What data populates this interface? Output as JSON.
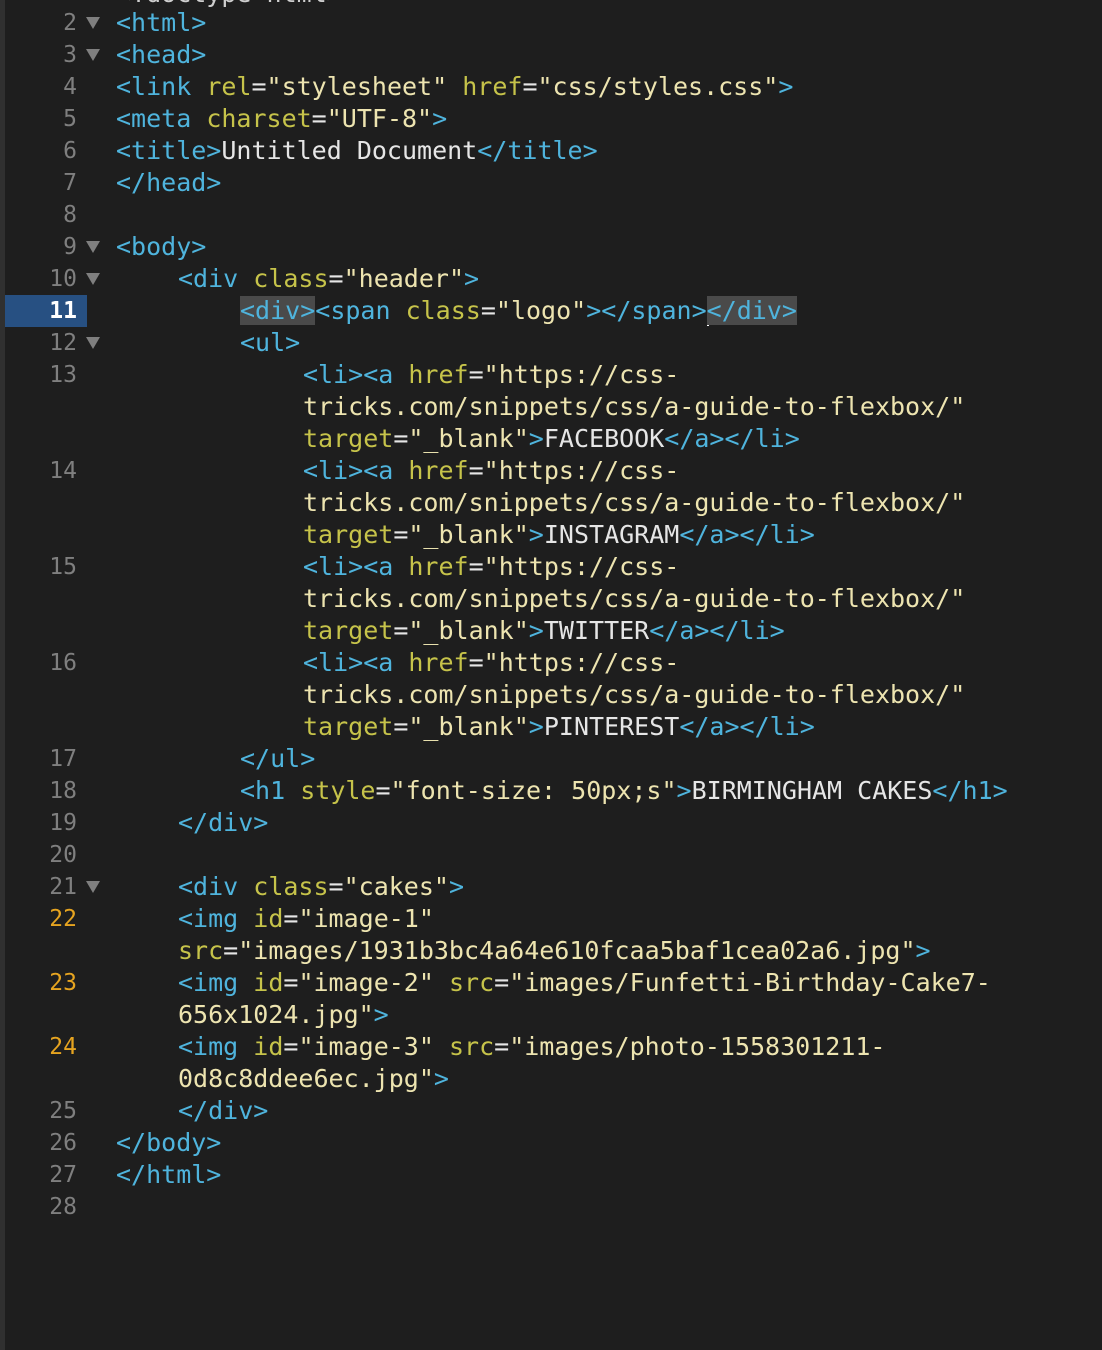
{
  "top_partial": "<!doctype html>",
  "lines": {
    "l2": {
      "num": "2",
      "t1": "<html>"
    },
    "l3": {
      "num": "3",
      "t1": "<head>"
    },
    "l4": {
      "num": "4",
      "t1": "<link ",
      "a1": "rel",
      "e1": "=",
      "s1": "\"stylesheet\"",
      "sp": " ",
      "a2": "href",
      "e2": "=",
      "s2": "\"css/styles.css\"",
      "t2": ">"
    },
    "l5": {
      "num": "5",
      "t1": "<meta ",
      "a1": "charset",
      "e1": "=",
      "s1": "\"UTF-8\"",
      "t2": ">"
    },
    "l6": {
      "num": "6",
      "t1": "<title>",
      "x1": "Untitled Document",
      "t2": "</title>"
    },
    "l7": {
      "num": "7",
      "t1": "</head>"
    },
    "l8": {
      "num": "8"
    },
    "l9": {
      "num": "9",
      "t1": "<body>"
    },
    "l10": {
      "num": "10",
      "t1": "<div ",
      "a1": "class",
      "e1": "=",
      "s1": "\"header\"",
      "t2": ">"
    },
    "l11": {
      "num": "11",
      "t1": "<div>",
      "t2": "<span ",
      "a1": "class",
      "e1": "=",
      "s1": "\"logo\"",
      "t3": "></span>",
      "t4": "</div>"
    },
    "l12": {
      "num": "12",
      "t1": "<ul>"
    },
    "l13": {
      "num": "13",
      "r1_t": "<li><a ",
      "r1_a": "href",
      "r1_e": "=",
      "r1_s": "\"https://css-",
      "r2_s": "tricks.com/snippets/css/a-guide-to-flexbox/\"",
      "r3_a": "target",
      "r3_e": "=",
      "r3_s": "\"_blank\"",
      "r3_t1": ">",
      "r3_x": "FACEBOOK",
      "r3_t2": "</a></li>"
    },
    "l14": {
      "num": "14",
      "r1_t": "<li><a ",
      "r1_a": "href",
      "r1_e": "=",
      "r1_s": "\"https://css-",
      "r2_s": "tricks.com/snippets/css/a-guide-to-flexbox/\"",
      "r3_a": "target",
      "r3_e": "=",
      "r3_s": "\"_blank\"",
      "r3_t1": ">",
      "r3_x": "INSTAGRAM",
      "r3_t2": "</a></li>"
    },
    "l15": {
      "num": "15",
      "r1_t": "<li><a ",
      "r1_a": "href",
      "r1_e": "=",
      "r1_s": "\"https://css-",
      "r2_s": "tricks.com/snippets/css/a-guide-to-flexbox/\"",
      "r3_a": "target",
      "r3_e": "=",
      "r3_s": "\"_blank\"",
      "r3_t1": ">",
      "r3_x": "TWITTER",
      "r3_t2": "</a></li>"
    },
    "l16": {
      "num": "16",
      "r1_t": "<li><a ",
      "r1_a": "href",
      "r1_e": "=",
      "r1_s": "\"https://css-",
      "r2_s": "tricks.com/snippets/css/a-guide-to-flexbox/\"",
      "r3_a": "target",
      "r3_e": "=",
      "r3_s": "\"_blank\"",
      "r3_t1": ">",
      "r3_x": "PINTEREST",
      "r3_t2": "</a></li>"
    },
    "l17": {
      "num": "17",
      "t1": "</ul>"
    },
    "l18": {
      "num": "18",
      "t1": "<h1 ",
      "a1": "style",
      "e1": "=",
      "s1": "\"font-size: 50px;s\"",
      "t2": ">",
      "x1": "BIRMINGHAM CAKES",
      "t3": "</h1>"
    },
    "l19": {
      "num": "19",
      "t1": "</div>"
    },
    "l20": {
      "num": "20"
    },
    "l21": {
      "num": "21",
      "t1": "<div ",
      "a1": "class",
      "e1": "=",
      "s1": "\"cakes\"",
      "t2": ">"
    },
    "l22": {
      "num": "22",
      "r1_t": "<img ",
      "r1_a": "id",
      "r1_e": "=",
      "r1_s": "\"image-1\"",
      "r2_a": "src",
      "r2_e": "=",
      "r2_s": "\"images/1931b3bc4a64e610fcaa5baf1cea02a6.jpg\"",
      "r2_t": ">"
    },
    "l23": {
      "num": "23",
      "r1_t": "<img ",
      "r1_a": "id",
      "r1_e": "=",
      "r1_s": "\"image-2\"",
      "r1_sp": " ",
      "r1_a2": "src",
      "r1_e2": "=",
      "r1_s2": "\"images/Funfetti-Birthday-Cake7-",
      "r2_s": "656x1024.jpg\"",
      "r2_t": ">"
    },
    "l24": {
      "num": "24",
      "r1_t": "<img ",
      "r1_a": "id",
      "r1_e": "=",
      "r1_s": "\"image-3\"",
      "r1_sp": " ",
      "r1_a2": "src",
      "r1_e2": "=",
      "r1_s2": "\"images/photo-1558301211-",
      "r2_s": "0d8c8ddee6ec.jpg\"",
      "r2_t": ">"
    },
    "l25": {
      "num": "25",
      "t1": "</div>"
    },
    "l26": {
      "num": "26",
      "t1": "</body>"
    },
    "l27": {
      "num": "27",
      "t1": "</html>"
    },
    "l28": {
      "num": "28"
    }
  }
}
